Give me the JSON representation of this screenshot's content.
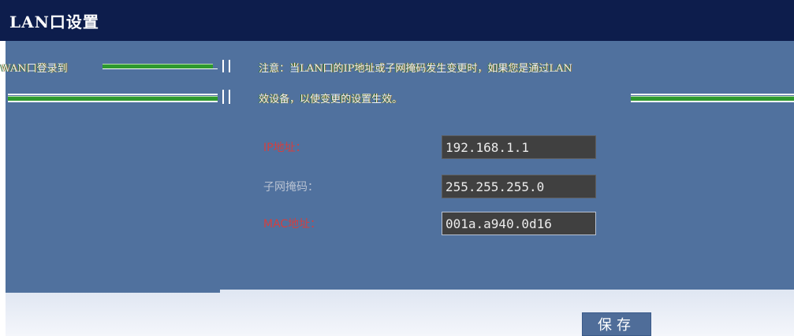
{
  "header": {
    "title": "LAN口设置"
  },
  "notice": {
    "left_text": "WAN口登录到",
    "line1": "注意：当LAN口的IP地址或子网掩码发生变更时，如果您是通过LAN",
    "line2": "效设备，以使变更的设置生效。"
  },
  "form": {
    "ip": {
      "label": "IP地址：",
      "value": "192.168.1.1"
    },
    "mask": {
      "label": "子网掩码：",
      "value": "255.255.255.0"
    },
    "mac": {
      "label": "MAC地址：",
      "value": "001a.a940.0d16"
    }
  },
  "actions": {
    "save_label": "保存"
  },
  "colors": {
    "header_bg": "#0d1d4c",
    "panel_bg": "#50719e",
    "label_red": "#d24040",
    "field_bg": "#404040"
  }
}
